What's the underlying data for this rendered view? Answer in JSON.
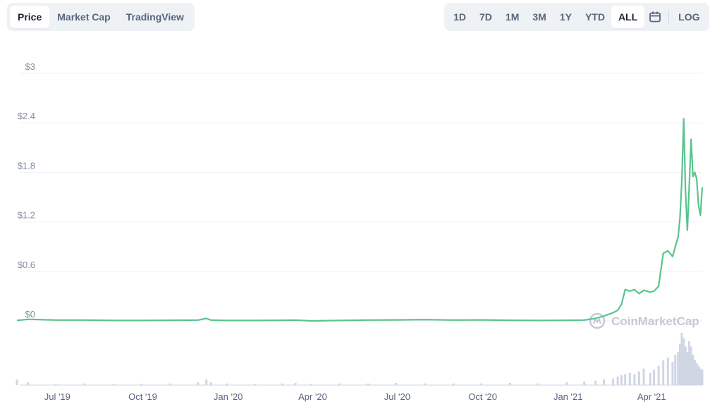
{
  "tabs": {
    "left": [
      {
        "label": "Price",
        "active": true
      },
      {
        "label": "Market Cap",
        "active": false
      },
      {
        "label": "TradingView",
        "active": false
      }
    ],
    "ranges": [
      {
        "label": "1D",
        "active": false
      },
      {
        "label": "7D",
        "active": false
      },
      {
        "label": "1M",
        "active": false
      },
      {
        "label": "3M",
        "active": false
      },
      {
        "label": "1Y",
        "active": false
      },
      {
        "label": "YTD",
        "active": false
      },
      {
        "label": "ALL",
        "active": true
      }
    ],
    "calendar_icon": "calendar-icon",
    "log_label": "LOG"
  },
  "watermark": "CoinMarketCap",
  "colors": {
    "line": "#58c48c",
    "grid": "#eff2f5",
    "volume": "#cfd6e4",
    "tab_bg": "#eff2f5"
  },
  "chart_data": {
    "type": "line",
    "y_ticks": [
      "$0",
      "$0.6",
      "$1.2",
      "$1.8",
      "$2.4",
      "$3"
    ],
    "ylim": [
      0,
      3
    ],
    "x_ticks": [
      "Jul '19",
      "Oct '19",
      "Jan '20",
      "Apr '20",
      "Jul '20",
      "Oct '20",
      "Jan '21",
      "Apr '21"
    ],
    "grid": true,
    "series": [
      {
        "values_x": [
          "2019-05-20",
          "2019-06-01",
          "2019-07-01",
          "2019-08-01",
          "2019-09-01",
          "2019-10-01",
          "2019-11-01",
          "2019-12-01",
          "2019-12-10",
          "2019-12-15",
          "2020-01-01",
          "2020-02-01",
          "2020-03-01",
          "2020-03-15",
          "2020-04-01",
          "2020-05-01",
          "2020-06-01",
          "2020-07-01",
          "2020-08-01",
          "2020-09-01",
          "2020-10-01",
          "2020-11-01",
          "2020-12-01",
          "2021-01-01",
          "2021-01-20",
          "2021-02-01",
          "2021-02-10",
          "2021-02-20",
          "2021-02-25",
          "2021-03-01",
          "2021-03-05",
          "2021-03-10",
          "2021-03-15",
          "2021-03-20",
          "2021-03-25",
          "2021-04-01",
          "2021-04-05",
          "2021-04-10",
          "2021-04-15",
          "2021-04-20",
          "2021-04-25",
          "2021-04-28",
          "2021-05-01",
          "2021-05-03",
          "2021-05-05",
          "2021-05-07",
          "2021-05-09",
          "2021-05-11",
          "2021-05-13",
          "2021-05-15",
          "2021-05-17",
          "2021-05-19",
          "2021-05-21",
          "2021-05-23",
          "2021-05-25",
          "2021-05-27"
        ],
        "values_y": [
          0.005,
          0.02,
          0.01,
          0.01,
          0.005,
          0.005,
          0.008,
          0.01,
          0.03,
          0.01,
          0.005,
          0.005,
          0.008,
          0.01,
          0.0,
          0.005,
          0.01,
          0.012,
          0.015,
          0.01,
          0.012,
          0.008,
          0.005,
          0.008,
          0.01,
          0.03,
          0.06,
          0.1,
          0.13,
          0.2,
          0.38,
          0.36,
          0.38,
          0.33,
          0.37,
          0.35,
          0.36,
          0.42,
          0.82,
          0.85,
          0.78,
          0.9,
          1.02,
          1.25,
          1.7,
          2.45,
          1.55,
          1.1,
          1.65,
          2.2,
          1.75,
          1.8,
          1.72,
          1.4,
          1.28,
          1.62
        ]
      }
    ],
    "volume": [
      0.1,
      0.05,
      0.02,
      0.03,
      0.02,
      0.02,
      0.03,
      0.05,
      0.1,
      0.05,
      0.03,
      0.02,
      0.03,
      0.04,
      0.02,
      0.03,
      0.03,
      0.04,
      0.03,
      0.03,
      0.03,
      0.04,
      0.03,
      0.05,
      0.06,
      0.08,
      0.1,
      0.12,
      0.15,
      0.18,
      0.2,
      0.22,
      0.2,
      0.25,
      0.3,
      0.22,
      0.28,
      0.35,
      0.45,
      0.5,
      0.42,
      0.55,
      0.6,
      0.75,
      0.95,
      0.85,
      0.7,
      0.6,
      0.8,
      0.7,
      0.55,
      0.45,
      0.4,
      0.35,
      0.3,
      0.28
    ]
  }
}
